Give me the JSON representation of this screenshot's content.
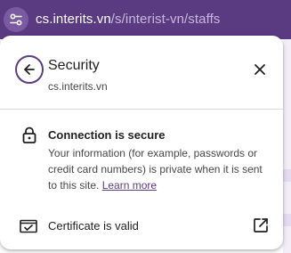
{
  "address_bar": {
    "host": "cs.interits.vn",
    "path": "/s/interist-vn/staffs",
    "site_info_icon": "tune-icon"
  },
  "popup": {
    "back_icon": "arrow-back-icon",
    "title": "Security",
    "subtitle": "cs.interits.vn",
    "close_icon": "close-icon",
    "connection": {
      "icon": "lock-icon",
      "title": "Connection is secure",
      "description": "Your information (for example, passwords or credit card numbers) is private when it is sent to this site.",
      "learn_more": "Learn more"
    },
    "certificate": {
      "icon": "certificate-icon",
      "label": "Certificate is valid",
      "action_icon": "open-in-new-icon"
    }
  },
  "colors": {
    "toolbar_bg": "#5a3a80",
    "accent": "#5b3d80",
    "text_primary": "#1f1f1f",
    "text_secondary": "#474747"
  }
}
